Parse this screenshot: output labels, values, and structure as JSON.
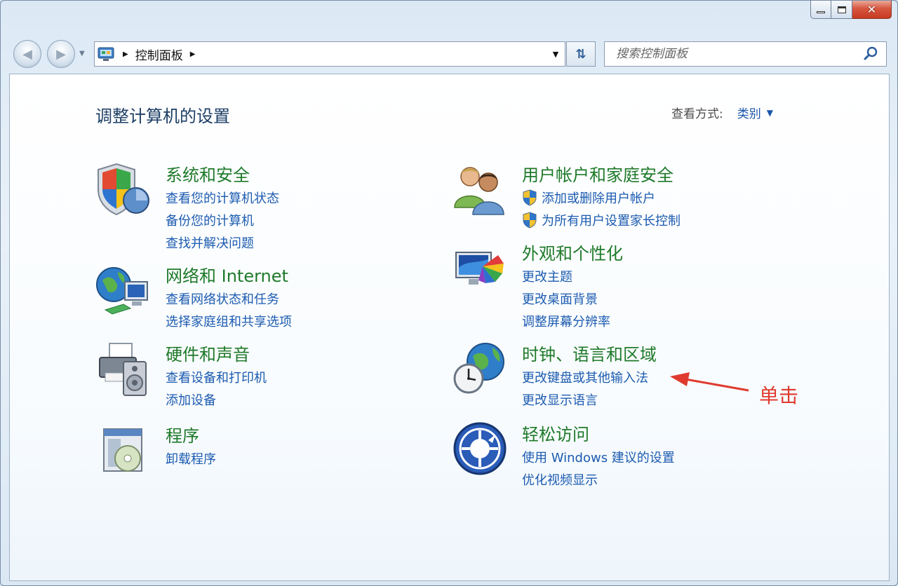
{
  "window": {
    "min_label": "",
    "max_label": "",
    "close_label": "✕"
  },
  "address_bar": {
    "crumb": "控制面板"
  },
  "search": {
    "placeholder": "搜索控制面板"
  },
  "header": {
    "title": "调整计算机的设置",
    "view_by_label": "查看方式:",
    "view_by_value": "类别"
  },
  "categories": [
    {
      "title": "系统和安全",
      "links": [
        "查看您的计算机状态",
        "备份您的计算机",
        "查找并解决问题"
      ],
      "icon": "shield-icon"
    },
    {
      "title": "网络和 Internet",
      "links": [
        "查看网络状态和任务",
        "选择家庭组和共享选项"
      ],
      "icon": "network-icon"
    },
    {
      "title": "硬件和声音",
      "links": [
        "查看设备和打印机",
        "添加设备"
      ],
      "icon": "printer-icon"
    },
    {
      "title": "程序",
      "links": [
        "卸载程序"
      ],
      "icon": "programs-icon"
    },
    {
      "title": "用户帐户和家庭安全",
      "links": [
        "添加或删除用户帐户",
        "为所有用户设置家长控制"
      ],
      "icon": "users-icon"
    },
    {
      "title": "外观和个性化",
      "links": [
        "更改主题",
        "更改桌面背景",
        "调整屏幕分辨率"
      ],
      "icon": "appearance-icon"
    },
    {
      "title": "时钟、语言和区域",
      "links": [
        "更改键盘或其他输入法",
        "更改显示语言"
      ],
      "icon": "clock-globe-icon"
    },
    {
      "title": "轻松访问",
      "links": [
        "使用 Windows 建议的设置",
        "优化视频显示"
      ],
      "icon": "ease-of-access-icon"
    }
  ],
  "annotation": {
    "text": "单击",
    "color": "#e03a2f"
  },
  "colors": {
    "category_title": "#1f7a2a",
    "link": "#1c5bb0",
    "page_title": "#1e3f66"
  }
}
